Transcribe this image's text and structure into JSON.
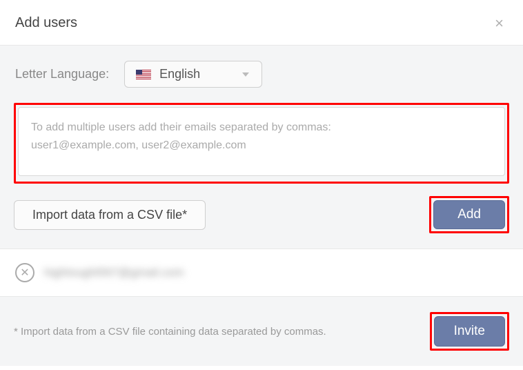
{
  "header": {
    "title": "Add users"
  },
  "language": {
    "label": "Letter Language:",
    "selected": "English"
  },
  "emailInput": {
    "placeholder": "To add multiple users add their emails separated by commas:\nuser1@example.com, user2@example.com",
    "value": ""
  },
  "buttons": {
    "import": "Import data from a CSV file*",
    "add": "Add",
    "invite": "Invite"
  },
  "pendingUsers": [
    {
      "email": "hightought567@gmail.com"
    }
  ],
  "footnote": "* Import data from a CSV file containing data separated by commas."
}
